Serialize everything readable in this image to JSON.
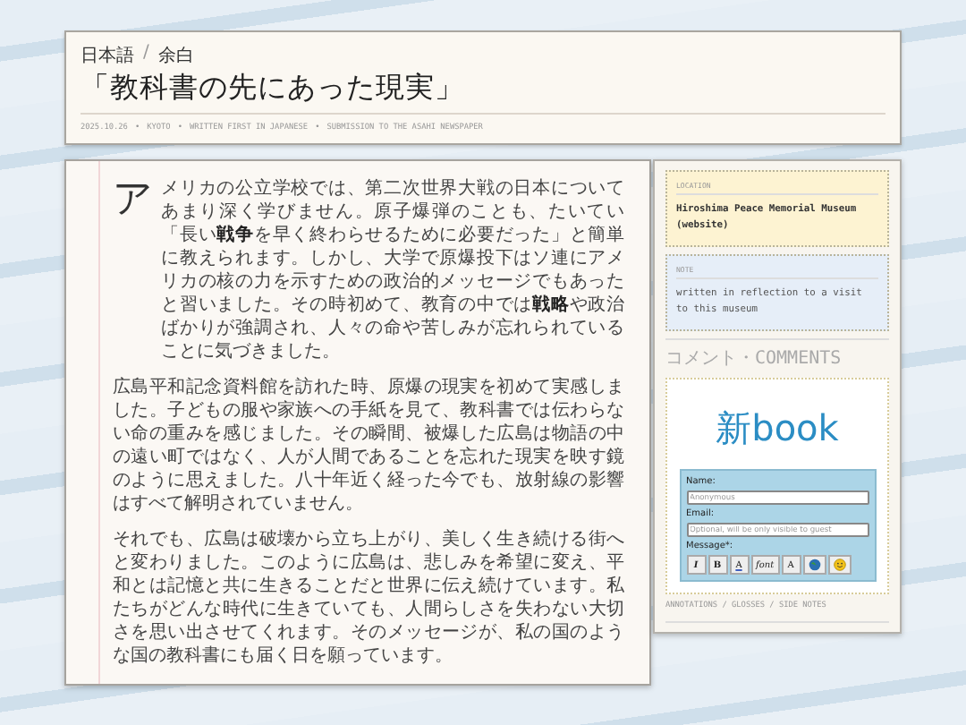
{
  "header": {
    "breadcrumb": {
      "items": [
        "日本語",
        "余白"
      ],
      "separator": "/"
    },
    "title": "「教科書の先にあった現実」",
    "meta": {
      "items": [
        "2025.10.26",
        "KYOTO",
        "WRITTEN FIRST IN JAPANESE",
        "SUBMISSION TO THE ASAHI NEWSPAPER"
      ],
      "separator": "•"
    }
  },
  "article": {
    "drop_cap": "ア",
    "paragraphs": [
      "メリカの公立学校では、第二次世界大戦の日本についてあまり深く学びません。原子爆弾のことも、たいてい「長い**戦争**を早く終わらせるために必要だった」と簡単に教えられます。しかし、大学で原爆投下はソ連にアメリカの核の力を示すための政治的メッセージでもあったと習いました。その時初めて、教育の中では**戦略**や政治ばかりが強調され、人々の命や苦しみが忘れられていることに気づきました。",
      "広島平和記念資料館を訪れた時、原爆の現実を初めて実感しました。子どもの服や家族への手紙を見て、教科書では伝わらない命の重みを感じました。その瞬間、被爆した広島は物語の中の遠い町ではなく、人が人間であることを忘れた現実を映す鏡のように思えました。八十年近く経った今でも、放射線の影響はすべて解明されていません。",
      "それでも、広島は破壊から立ち上がり、美しく生き続ける街へと変わりました。このように広島は、悲しみを希望に変え、平和とは記憶と共に生きることだと世界に伝え続けています。私たちがどんな時代に生きていても、人間らしさを失わない大切さを思い出させてくれます。そのメッセージが、私の国のような国の教科書にも届く日を願っています。"
    ]
  },
  "sidebar": {
    "location": {
      "label": "LOCATION",
      "text": "Hiroshima Peace Memorial Museum (website)"
    },
    "note": {
      "label": "NOTE",
      "text": "written in reflection to a visit to this museum"
    },
    "comments_heading": "コメント・COMMENTS",
    "guestbook": {
      "logo_prefix": "新",
      "logo_suffix": "book",
      "fields": [
        {
          "label": "Name:",
          "placeholder": "Anonymous"
        },
        {
          "label": "Email:",
          "placeholder": "Optional, will be only visible to guest"
        }
      ],
      "message_label": "Message*:",
      "toolbar": [
        {
          "kind": "italic",
          "label": "I"
        },
        {
          "kind": "bold",
          "label": "B"
        },
        {
          "kind": "color",
          "label": "A"
        },
        {
          "kind": "font",
          "label": "font"
        },
        {
          "kind": "size",
          "label": "A"
        },
        {
          "kind": "globe"
        },
        {
          "kind": "smiley"
        }
      ]
    },
    "footer": "ANNOTATIONS / GLOSSES / SIDE NOTES"
  }
}
